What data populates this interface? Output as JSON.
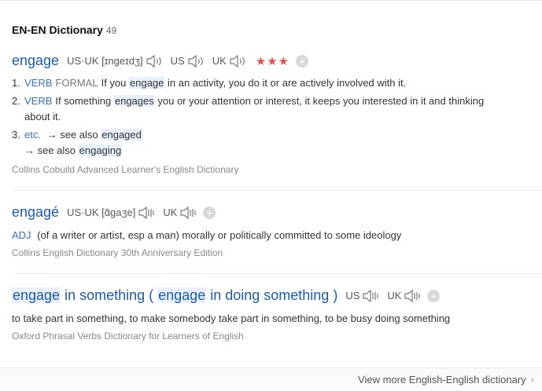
{
  "section": {
    "title": "EN-EN Dictionary",
    "count": "49"
  },
  "entry1": {
    "headword": "engage",
    "us_uk_label": "US·UK",
    "phonetic": "[ɪnɡeɪdʒ]",
    "us_label": "US",
    "uk_label": "UK",
    "stars": "★★★",
    "plus": "+",
    "defs": [
      {
        "num": "1.",
        "pos": "VERB",
        "register": "FORMAL",
        "pre": "If you",
        "hl": "engage",
        "post": "in an activity, you do it or are actively involved with it."
      },
      {
        "num": "2.",
        "pos": "VERB",
        "pre": "If something",
        "hl": "engages",
        "post": "you or your attention or interest, it keeps you interested in it and thinking",
        "cont": "about it."
      },
      {
        "num": "3.",
        "pos": "etc.",
        "see1_pre": "→ see also",
        "see1_hl": "engaged",
        "see2_pre": "→ see also",
        "see2_hl": "engaging"
      }
    ],
    "source": "Collins Cobuild Advanced Learner's English Dictionary"
  },
  "entry2": {
    "headword": "engagé",
    "us_uk_label": "US·UK",
    "phonetic": "[ɑ̃ɡaʒe]",
    "uk_label": "UK",
    "plus": "+",
    "pos": "ADJ",
    "def": "(of a writer or artist, esp a man) morally or politically committed to some ideology",
    "source": "Collins English Dictionary 30th Anniversary Edition"
  },
  "entry3": {
    "hw1": "engage",
    "mid1": " in something ( ",
    "hw2": "engage",
    "mid2": " in doing something )",
    "us_label": "US",
    "uk_label": "UK",
    "plus": "+",
    "def": "to take part in something, to make somebody take part in something, to be busy doing something",
    "source": "Oxford Phrasal Verbs Dictionary for Learners of English"
  },
  "footer": {
    "more": "View more English-English dictionary",
    "chevron": "›"
  },
  "icons": {
    "speaker": "speaker-icon",
    "plus": "add-icon",
    "chevron": "chevron-right-icon"
  },
  "colors": {
    "headword": "#1a5bb0",
    "pos": "#3470c2",
    "stars": "#e0514e",
    "highlight": "#e8f1fb"
  }
}
